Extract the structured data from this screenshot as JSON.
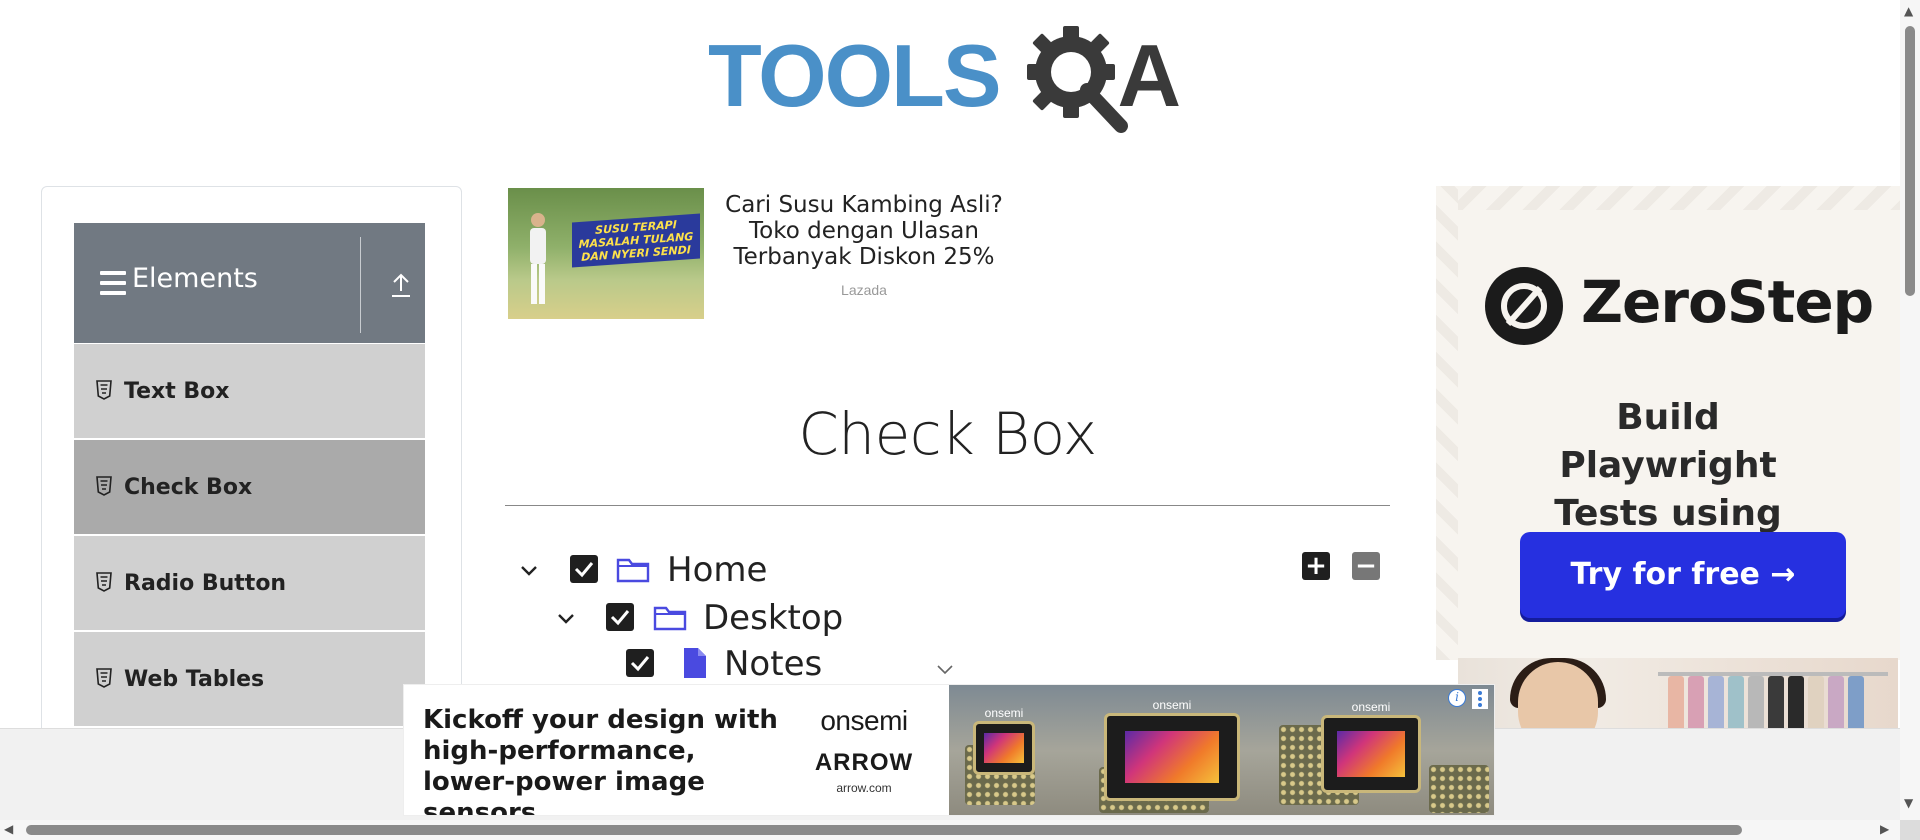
{
  "header": {
    "logo_primary": "TOOLS",
    "logo_secondary": "A"
  },
  "sidebar": {
    "group_title": "Elements",
    "items": [
      {
        "label": "Text Box",
        "active": false
      },
      {
        "label": "Check Box",
        "active": true
      },
      {
        "label": "Radio Button",
        "active": false
      },
      {
        "label": "Web Tables",
        "active": false
      }
    ]
  },
  "top_ad": {
    "image_banner": "SUSU TERAPI MASALAH TULANG DAN NYERI SENDI",
    "headline": "Cari Susu Kambing Asli? Toko dengan Ulasan Terbanyak Diskon 25%",
    "brand": "Lazada"
  },
  "main": {
    "title": "Check Box",
    "expand_all_label": "+",
    "collapse_all_label": "−",
    "tree": [
      {
        "label": "Home",
        "checked": true,
        "expanded": true,
        "icon": "folder-icon"
      },
      {
        "label": "Desktop",
        "checked": true,
        "expanded": true,
        "icon": "folder-icon"
      },
      {
        "label": "Notes",
        "checked": true,
        "icon": "file-icon"
      }
    ]
  },
  "right_ad": {
    "brand": "ZeroStep",
    "tagline": "Build Playwright Tests using AI",
    "cta": "Try for free →",
    "cta_color": "#2630e0"
  },
  "bottom_ad": {
    "text": "Kickoff your design with high-performance, lower-power image sensors",
    "brand1": "onsemi",
    "brand2": "ARROW",
    "url": "arrow.com",
    "chip_labels": [
      "onsemi",
      "onsemi",
      "onsemi"
    ],
    "info_icon": "i"
  },
  "colors": {
    "logo_blue": "#4a90c8",
    "sidebar_header": "#717982",
    "sidebar_item": "#d0d0d0",
    "sidebar_item_active": "#aaaaaa",
    "tree_icon": "#4a4ae0"
  }
}
